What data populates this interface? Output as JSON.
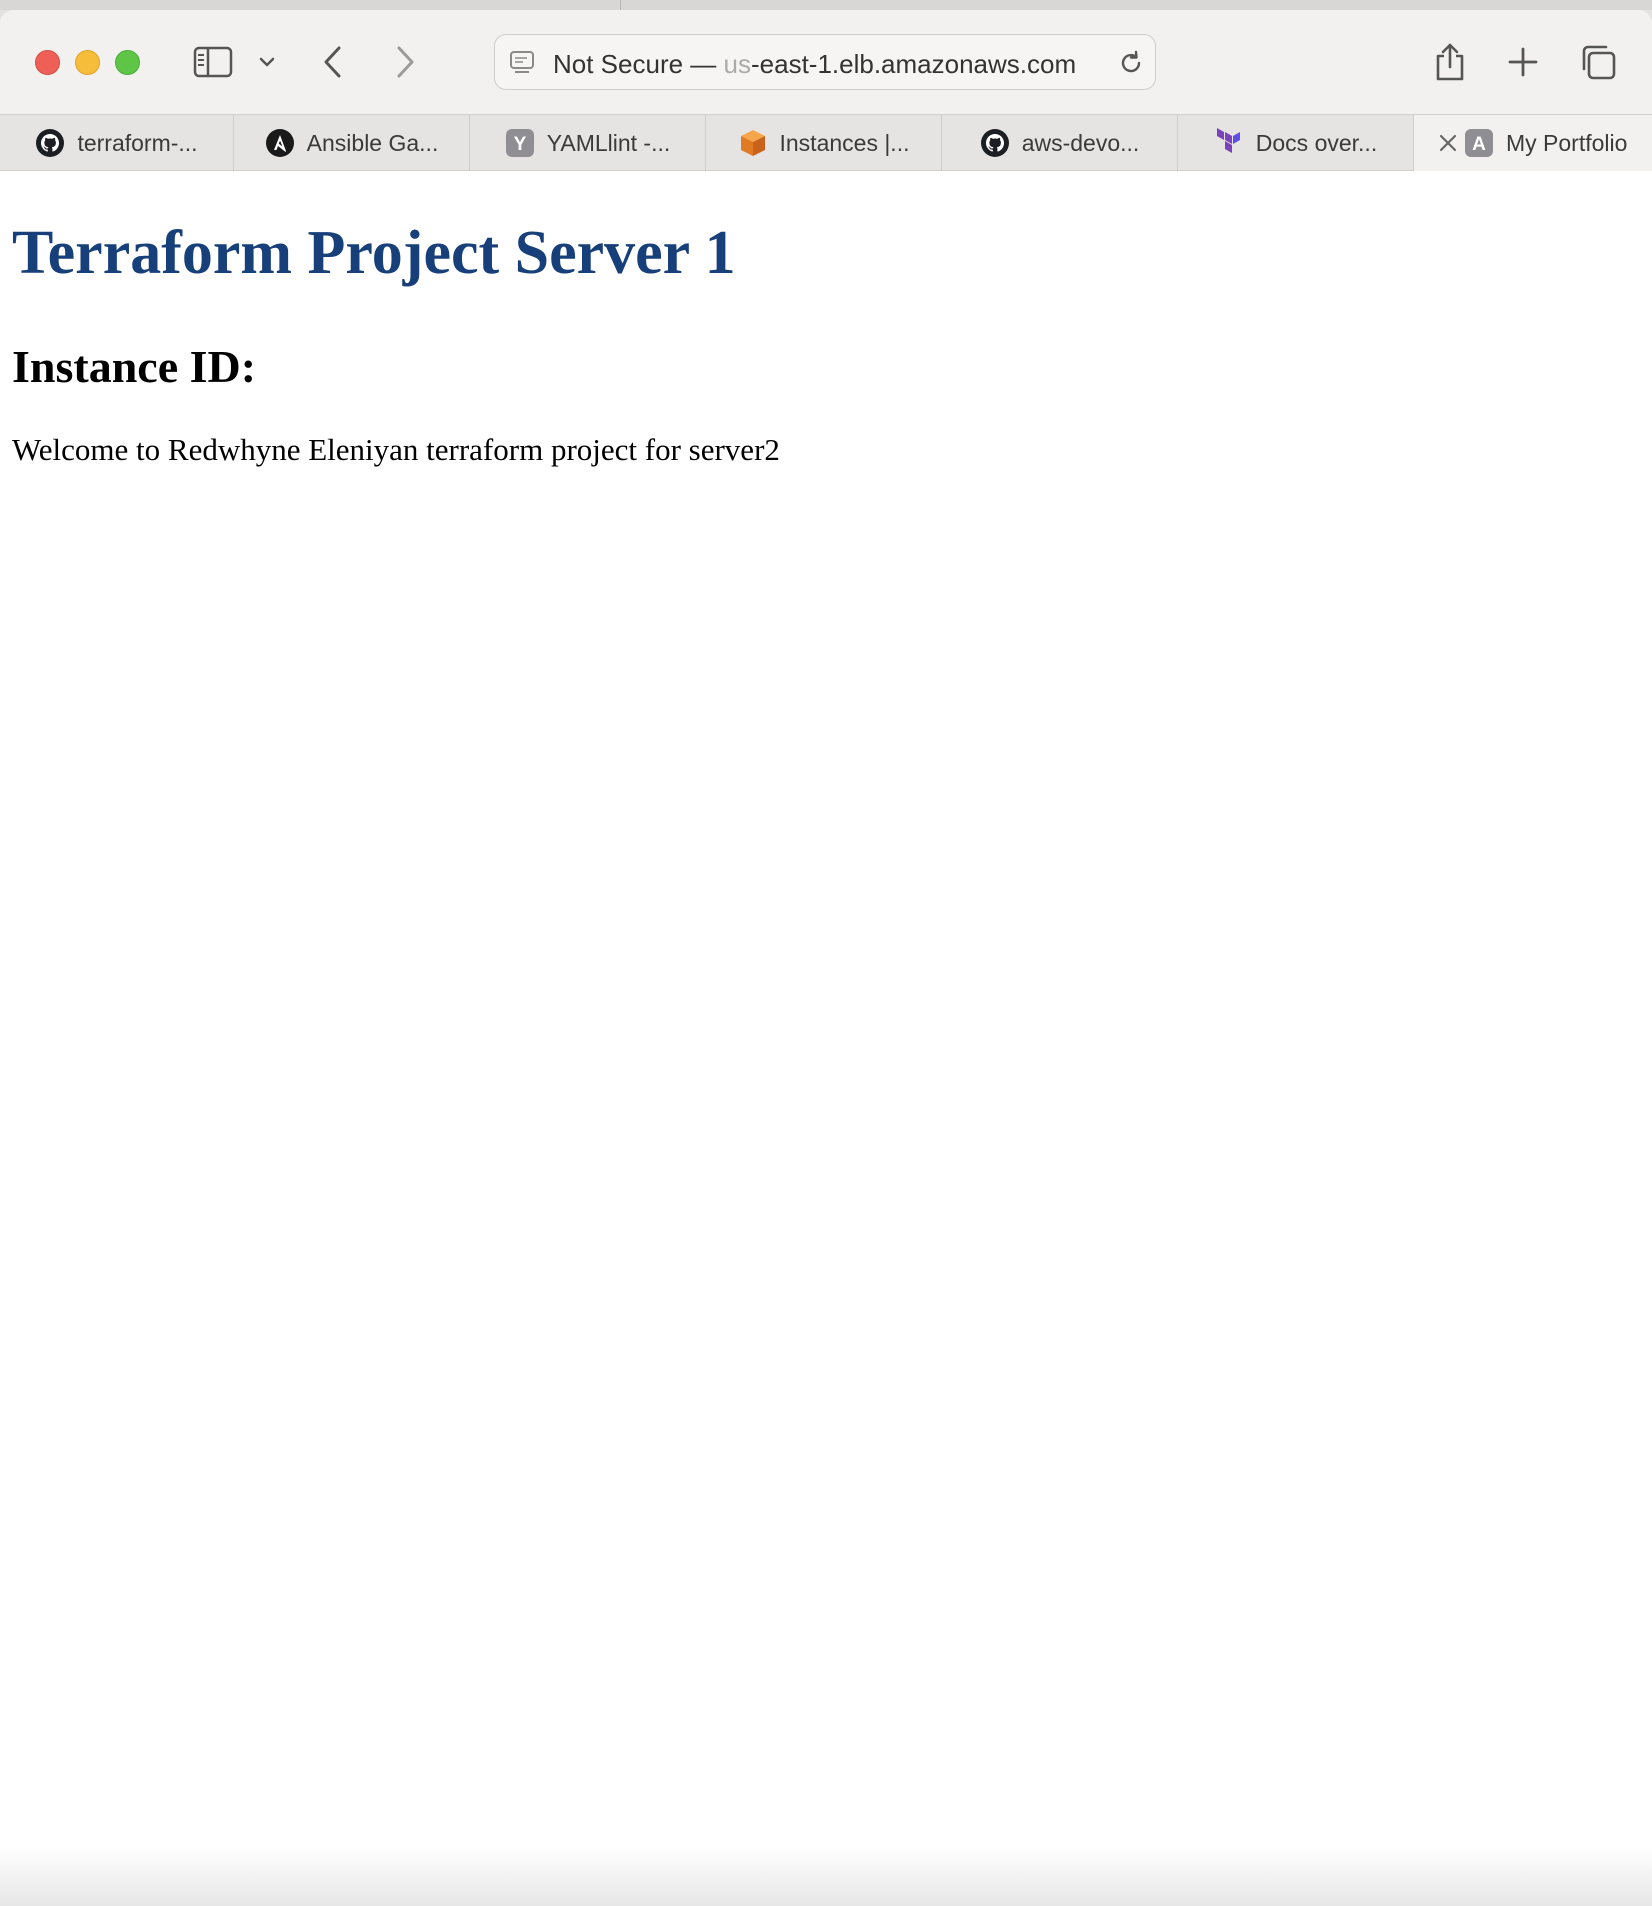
{
  "address_bar": {
    "prefix": "Not Secure — ",
    "faded": "us",
    "domain": "-east-1.elb.amazonaws.com"
  },
  "tabs": [
    {
      "label": "terraform-...",
      "icon": "github-icon"
    },
    {
      "label": "Ansible Ga...",
      "icon": "ansible-icon"
    },
    {
      "label": "YAMLlint -...",
      "icon": "yamllint-icon"
    },
    {
      "label": "Instances |...",
      "icon": "aws-cube-icon"
    },
    {
      "label": "aws-devo...",
      "icon": "github-icon"
    },
    {
      "label": "Docs over...",
      "icon": "terraform-icon"
    },
    {
      "label": "My Portfolio",
      "icon": "letter-a-icon",
      "active": true
    }
  ],
  "page": {
    "heading": "Terraform Project Server 1",
    "subheading": "Instance ID:",
    "paragraph": "Welcome to Redwhyne Eleniyan terraform project for server2"
  },
  "colors": {
    "heading": "#173f7a",
    "close_button": "#ee5f57",
    "minimize_button": "#f6bd3b",
    "zoom_button": "#5ec547"
  }
}
